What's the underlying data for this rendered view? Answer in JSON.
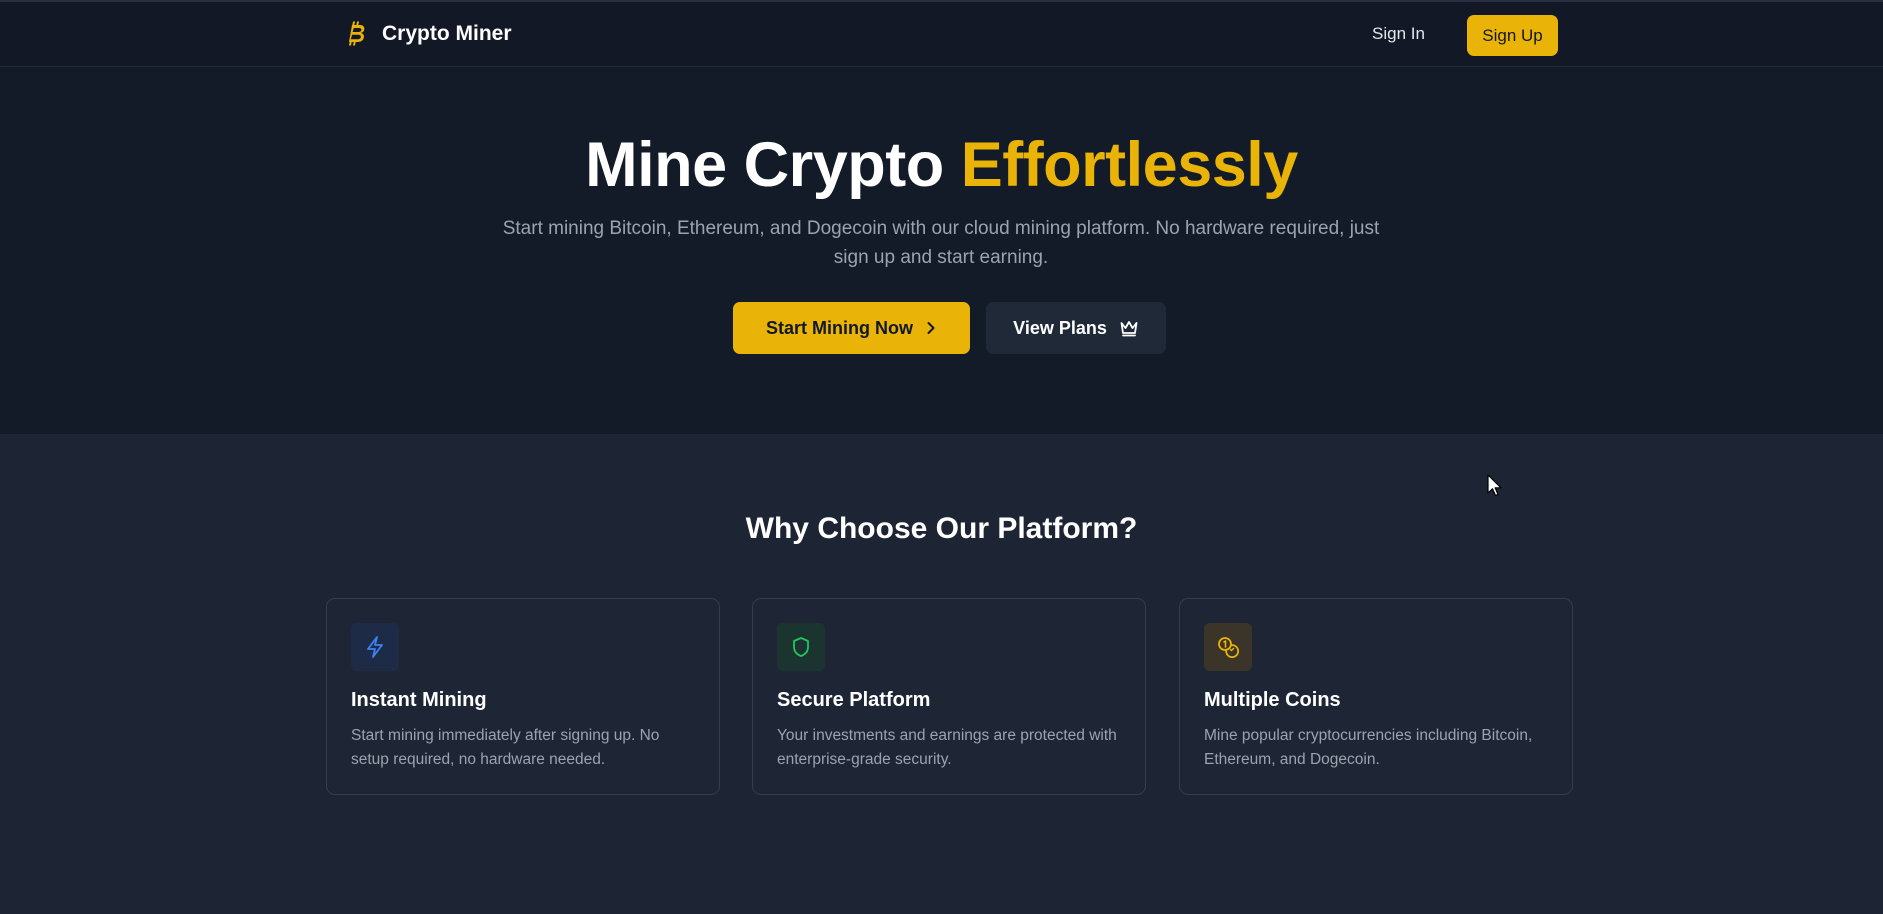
{
  "nav": {
    "brand": "Crypto Miner",
    "brand_icon": "bitcoin-icon",
    "sign_in": "Sign In",
    "sign_up": "Sign Up"
  },
  "hero": {
    "title_main": "Mine Crypto",
    "title_accent": "Effortlessly",
    "subtitle": "Start mining Bitcoin, Ethereum, and Dogecoin with our cloud mining platform. No hardware required, just sign up and start earning.",
    "primary_button": "Start Mining Now",
    "primary_icon": "chevron-right-icon",
    "secondary_button": "View Plans",
    "secondary_icon": "crown-icon"
  },
  "features": {
    "title": "Why Choose Our Platform?",
    "items": [
      {
        "icon": "lightning-icon",
        "title": "Instant Mining",
        "description": "Start mining immediately after signing up. No setup required, no hardware needed."
      },
      {
        "icon": "shield-icon",
        "title": "Secure Platform",
        "description": "Your investments and earnings are protected with enterprise-grade security."
      },
      {
        "icon": "coins-icon",
        "title": "Multiple Coins",
        "description": "Mine popular cryptocurrencies including Bitcoin, Ethereum, and Dogecoin."
      }
    ]
  },
  "colors": {
    "accent": "#eab308",
    "nav_bg": "#121826",
    "hero_bg": "#131a28",
    "page_bg": "#1d2433",
    "card_bg": "#1e2635",
    "lightning": "#3b82f6",
    "shield": "#22c55e",
    "coins": "#eab308"
  }
}
